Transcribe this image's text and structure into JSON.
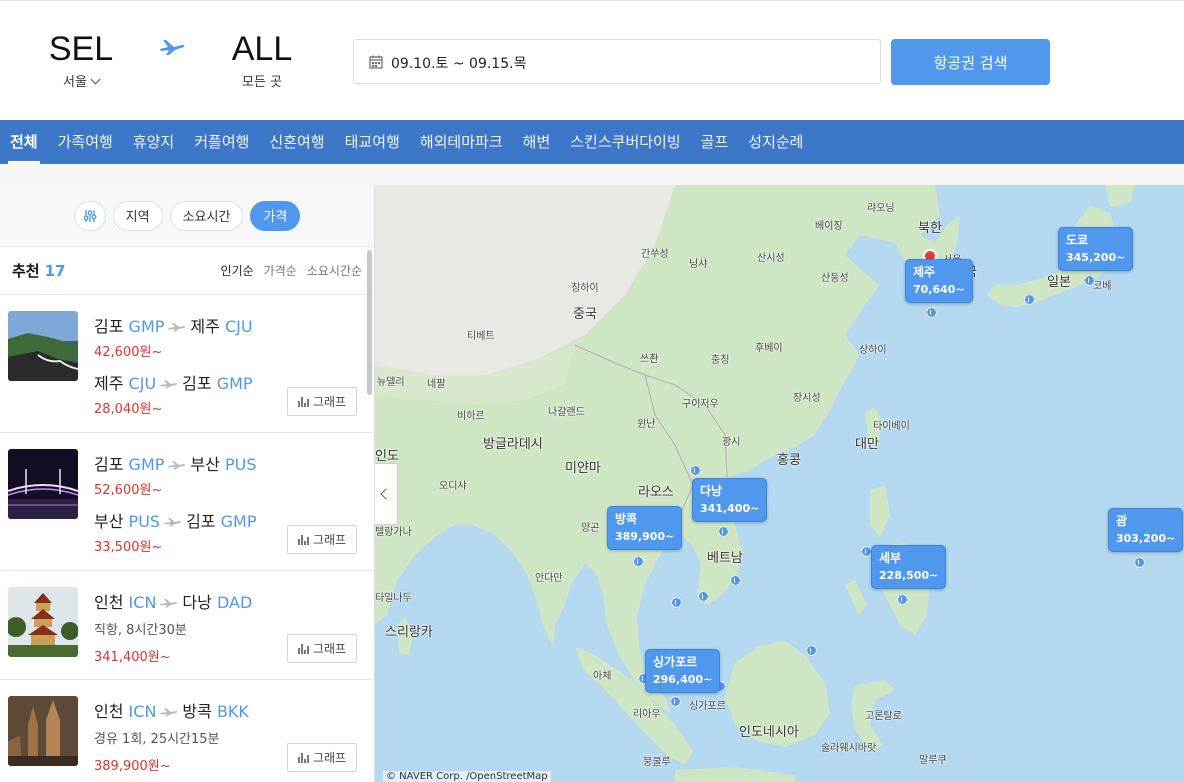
{
  "header": {
    "origin_code": "SEL",
    "origin_city": "서울",
    "dest_code": "ALL",
    "dest_city": "모든 곳",
    "date_range": "09.10.토 ~ 09.15.목",
    "search_label": "항공권 검색",
    "accent": "#4f98ee"
  },
  "categories": [
    "전체",
    "가족여행",
    "휴양지",
    "커플여행",
    "신혼여행",
    "태교여행",
    "해외테마파크",
    "해변",
    "스킨스쿠버다이빙",
    "골프",
    "성지순례"
  ],
  "filters": {
    "region": "지역",
    "duration": "소요시간",
    "price": "가격"
  },
  "list": {
    "title": "추천",
    "count": "17",
    "sort_popular": "인기순",
    "sort_price": "가격순",
    "sort_duration": "소요시간순",
    "graph_label": "그래프",
    "items": [
      {
        "leg1": {
          "from": "김포",
          "from_code": "GMP",
          "to": "제주",
          "to_code": "CJU",
          "price": "42,600원~"
        },
        "leg2": {
          "from": "제주",
          "from_code": "CJU",
          "to": "김포",
          "to_code": "GMP",
          "price": "28,040원~"
        }
      },
      {
        "leg1": {
          "from": "김포",
          "from_code": "GMP",
          "to": "부산",
          "to_code": "PUS",
          "price": "52,600원~"
        },
        "leg2": {
          "from": "부산",
          "from_code": "PUS",
          "to": "김포",
          "to_code": "GMP",
          "price": "33,500원~"
        }
      },
      {
        "leg1": {
          "from": "인천",
          "from_code": "ICN",
          "to": "다낭",
          "to_code": "DAD"
        },
        "info": "직항, 8시간30분",
        "price": "341,400원~"
      },
      {
        "leg1": {
          "from": "인천",
          "from_code": "ICN",
          "to": "방콕",
          "to_code": "BKK"
        },
        "info": "경유 1회, 25시간15분",
        "price": "389,900원~"
      }
    ]
  },
  "map": {
    "bubbles": [
      {
        "city": "제주",
        "price": "70,640~"
      },
      {
        "city": "도쿄",
        "price": "345,200~"
      },
      {
        "city": "다낭",
        "price": "341,400~"
      },
      {
        "city": "방콕",
        "price": "389,900~"
      },
      {
        "city": "세부",
        "price": "228,500~"
      },
      {
        "city": "괌",
        "price": "303,200~"
      },
      {
        "city": "싱가포르",
        "price": "296,400~"
      }
    ],
    "labels": {
      "jungguk": "중국",
      "tibet": "티베트",
      "nepal": "네팔",
      "newdelhi": "뉴델리",
      "bihar": "비하르",
      "nagaland": "나갈랜드",
      "bangladesh": "방글라데시",
      "myanmar": "미얀마",
      "odisha": "오디샤",
      "india": "인도",
      "telangana": "텔랑가나",
      "karnataka": "카르나타카",
      "tamilnadu": "타밀나두",
      "srilanka": "스리랑카",
      "andaman": "안다만",
      "laos": "라오스",
      "vietnam": "베트남",
      "hanoi": "하노이",
      "yangon": "양곤",
      "hongkong": "홍콩",
      "taiwan": "대만",
      "taipei": "타이베이",
      "gwangsi": "광시",
      "yunnan": "윈난",
      "guizhou": "구이저우",
      "sichuan": "쓰촨",
      "chongqing": "충칭",
      "hubei": "후베이",
      "shanghai": "상하이",
      "jiangxi": "장시성",
      "qinghai": "칭하이",
      "gansu": "간쑤성",
      "ningxia": "닝샤",
      "shanxi": "산시성",
      "shandong": "산둥성",
      "liaoning": "랴오닝",
      "beijing": "베이징",
      "bukhan": "북한",
      "seoul": "서울",
      "hanguk": "한국",
      "ilbon": "일본",
      "kobe": "코베",
      "tokyo": "도쿄",
      "philippines": "필리핀",
      "indonesia": "인도네시아",
      "sulawesi": "술라웨시바랏",
      "gorontalo": "고론탈로",
      "maluku": "말루쿠",
      "bengkulu": "붕쿨루",
      "riau": "리아우",
      "aceh": "아체",
      "malaysia": "말레이시아",
      "singapore": "싱가포르",
      "bangkok": "방콕"
    },
    "copyright": "© NAVER Corp. /OpenStreetMap"
  }
}
